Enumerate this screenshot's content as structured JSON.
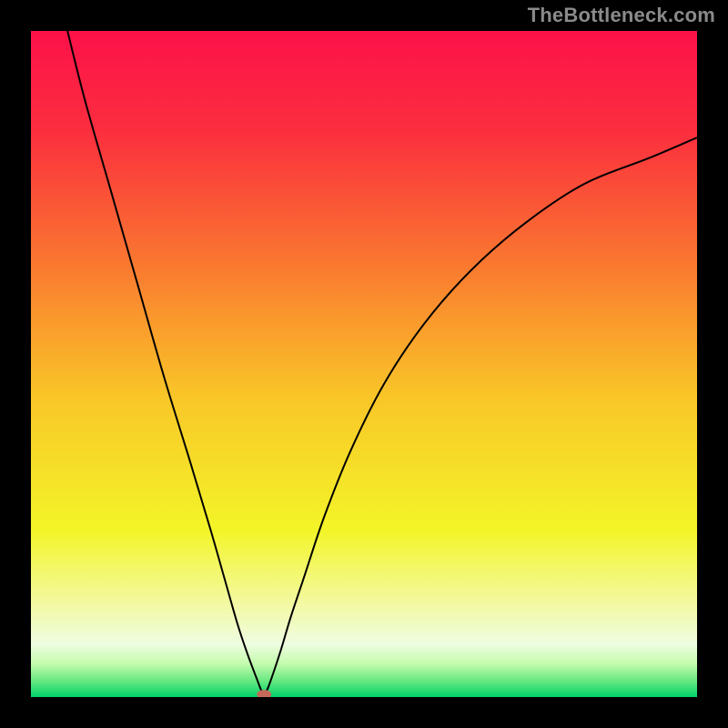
{
  "watermark": "TheBottleneck.com",
  "chart_data": {
    "type": "line",
    "title": "",
    "xlabel": "",
    "ylabel": "",
    "xlim": [
      0,
      100
    ],
    "ylim": [
      0,
      100
    ],
    "grid": false,
    "legend": false,
    "background": {
      "gradient_stops": [
        {
          "pos": 0,
          "color": "#fc1149"
        },
        {
          "pos": 0.15,
          "color": "#fb2e3e"
        },
        {
          "pos": 0.35,
          "color": "#fa7830"
        },
        {
          "pos": 0.55,
          "color": "#f9c628"
        },
        {
          "pos": 0.75,
          "color": "#f3f528"
        },
        {
          "pos": 0.86,
          "color": "#f3f9a2"
        },
        {
          "pos": 0.92,
          "color": "#eefde1"
        },
        {
          "pos": 0.95,
          "color": "#c4fcad"
        },
        {
          "pos": 0.975,
          "color": "#6ae982"
        },
        {
          "pos": 1.0,
          "color": "#00d36a"
        }
      ]
    },
    "series": [
      {
        "name": "bottleneck-curve",
        "color": "#000000",
        "x": [
          5,
          8,
          12,
          16,
          20,
          24,
          27,
          29,
          31,
          32.5,
          34,
          34.7,
          35.3,
          36,
          37.5,
          39,
          41,
          44,
          48,
          53,
          59,
          66,
          74,
          83,
          93,
          100
        ],
        "y": [
          102,
          90,
          76,
          62,
          48,
          35,
          25,
          18,
          11,
          6.5,
          2.5,
          0.8,
          0.8,
          2.5,
          7,
          12,
          18,
          27,
          37,
          47,
          56,
          64,
          71,
          77,
          81,
          84
        ]
      }
    ],
    "marker": {
      "name": "optimal-point",
      "x": 35,
      "y": 0.4,
      "color": "#c56a5a",
      "rx": 8,
      "ry": 5
    }
  }
}
